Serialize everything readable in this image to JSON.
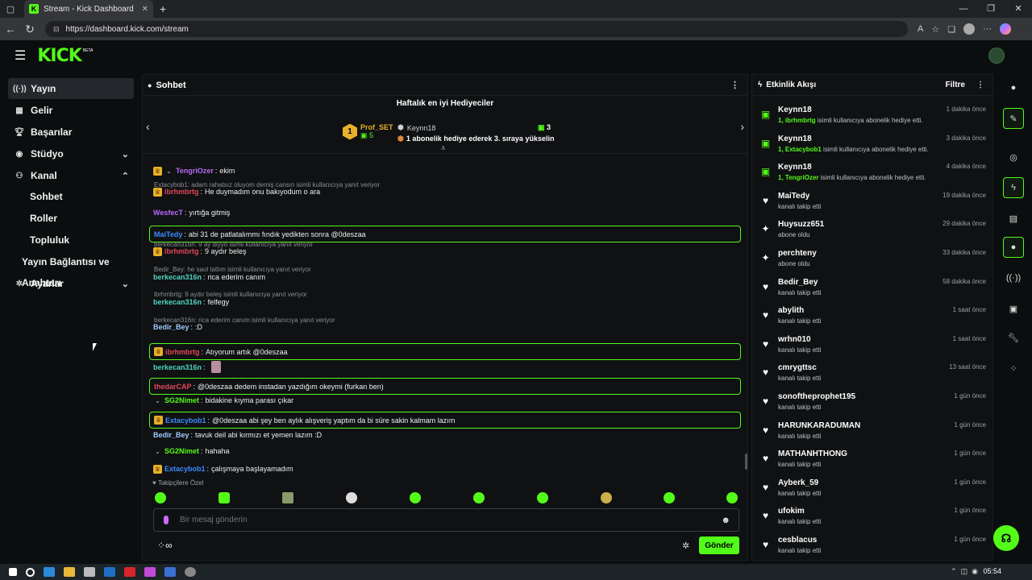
{
  "browser": {
    "tab_title": "Stream - Kick Dashboard",
    "tab_icon_letter": "K",
    "url": "https://dashboard.kick.com/stream"
  },
  "header": {
    "logo": "KICK",
    "beta": "BETA"
  },
  "sidebar": {
    "items": [
      {
        "label": "Yayın",
        "icon": "broadcast-icon"
      },
      {
        "label": "Gelir",
        "icon": "revenue-icon"
      },
      {
        "label": "Başarılar",
        "icon": "trophy-icon"
      },
      {
        "label": "Stüdyo",
        "icon": "studio-icon"
      },
      {
        "label": "Kanal",
        "icon": "channel-icon"
      },
      {
        "label": "Ayarlar",
        "icon": "gear-icon"
      }
    ],
    "subitems": [
      "Sohbet",
      "Roller",
      "Topluluk",
      "Yayın Bağlantısı ve Anahtarı"
    ]
  },
  "chat": {
    "title": "Sohbet",
    "gifters_title": "Haftalık en iyi Hediyeciler",
    "top_gifter": {
      "rank": "1",
      "name": "Prof_SET",
      "count": "5"
    },
    "next_gifter": {
      "name": "Keynn18",
      "count": "3",
      "hint": "1 abonelik hediye ederek 3. sıraya yükselin"
    },
    "messages": [
      {
        "reply": "",
        "user": "TengriOzer",
        "color": "#b96bff",
        "text": "ekim"
      },
      {
        "reply": "Extacybob1: adam rahatsız oluyom demiş cansın isimli kullanıcıya yanıt veriyor",
        "user": "ibrhmbrtg",
        "color": "#e2465a",
        "text": "He duymadım onu bakıyodum o ara"
      },
      {
        "reply": "",
        "user": "WesfecT",
        "color": "#b96bff",
        "text": "yırtığa gitmiş"
      },
      {
        "reply": "",
        "user": "MaiTedy",
        "color": "#3d8bff",
        "text": "abi 31 de patlatalımmı fındık yedikten sonra @0deszaa"
      },
      {
        "reply": "berkecan316n: 9 ay diyyo isimli kullanıcıya yanıt veriyor",
        "user": "ibrhmbrtg",
        "color": "#e2465a",
        "text": "9 aydır beleş"
      },
      {
        "reply": "Bedir_Bey: he saol tatlım isimli kullanıcıya yanıt veriyor",
        "user": "berkecan316n",
        "color": "#4fd4c0",
        "text": "rica ederim canım"
      },
      {
        "reply": "ibrhmbrtg: 9 aydır beleş isimli kullanıcıya yanıt veriyor",
        "user": "berkecan316n",
        "color": "#4fd4c0",
        "text": "felfegy"
      },
      {
        "reply": "berkecan316n: rica ederim canım isimli kullanıcıya yanıt veriyor",
        "user": "Bedir_Bey",
        "color": "#9ecbff",
        "text": ":D"
      },
      {
        "reply": "",
        "user": "ibrhmbrtg",
        "color": "#e2465a",
        "text": "Atıyorum artık @0deszaa"
      },
      {
        "reply": "",
        "user": "berkecan316n",
        "color": "#4fd4c0",
        "text": ""
      },
      {
        "reply": "",
        "user": "thedarCAP",
        "color": "#e2465a",
        "text": "@0deszaa dedem instadan yazdığım okeymi (furkan ben)"
      },
      {
        "reply": "",
        "user": "SG2Nimet",
        "color": "#53fc18",
        "text": "bidakine kıyma parası çıkar"
      },
      {
        "reply": "",
        "user": "Extacybob1",
        "color": "#3d8bff",
        "text": "@0deszaa abi şey ben aylık alışveriş yaptım da bi süre sakin kalmam lazım"
      },
      {
        "reply": "",
        "user": "Bedir_Bey",
        "color": "#9ecbff",
        "text": "tavuk deil abi kırmızı et yemen lazım :D"
      },
      {
        "reply": "",
        "user": "SG2Nimet",
        "color": "#53fc18",
        "text": "hahaha"
      },
      {
        "reply": "",
        "user": "Extacybob1",
        "color": "#3d8bff",
        "text": "çalışmaya başlayamadım"
      }
    ],
    "emote_label": "Takipçilere Özel",
    "input_placeholder": "Bir mesaj gönderin",
    "send_label": "Gönder"
  },
  "feed": {
    "title": "Etkinlik Akışı",
    "filter_label": "Filtre",
    "items": [
      {
        "icon": "gift-icon",
        "name": "Keynn18",
        "time": "1 dakika önce",
        "gift_prefix": "1, ibrhmbrtg",
        "sub": "isimli kullanıcıya abonelik hediye etti."
      },
      {
        "icon": "gift-icon",
        "name": "Keynn18",
        "time": "3 dakika önce",
        "gift_prefix": "1, Extacybob1",
        "sub": "isimli kullanıcıya abonelik hediye etti."
      },
      {
        "icon": "gift-icon",
        "name": "Keynn18",
        "time": "4 dakika önce",
        "gift_prefix": "1, TengriOzer",
        "sub": "isimli kullanıcıya abonelik hediye etti."
      },
      {
        "icon": "heart-icon",
        "name": "MaiTedy",
        "time": "19 dakika önce",
        "gift_prefix": "",
        "sub": "kanalı takip etti"
      },
      {
        "icon": "sparkle-icon",
        "name": "Huysuzz651",
        "time": "29 dakika önce",
        "gift_prefix": "",
        "sub": "abone oldu"
      },
      {
        "icon": "sparkle-icon",
        "name": "perchteny",
        "time": "33 dakika önce",
        "gift_prefix": "",
        "sub": "abone oldu"
      },
      {
        "icon": "heart-icon",
        "name": "Bedir_Bey",
        "time": "58 dakika önce",
        "gift_prefix": "",
        "sub": "kanalı takip etti"
      },
      {
        "icon": "heart-icon",
        "name": "abylith",
        "time": "1 saat önce",
        "gift_prefix": "",
        "sub": "kanalı takip etti"
      },
      {
        "icon": "heart-icon",
        "name": "wrhn010",
        "time": "1 saat önce",
        "gift_prefix": "",
        "sub": "kanalı takip etti"
      },
      {
        "icon": "heart-icon",
        "name": "cmrygttsc",
        "time": "13 saat önce",
        "gift_prefix": "",
        "sub": "kanalı takip etti"
      },
      {
        "icon": "heart-icon",
        "name": "sonoftheprophet195",
        "time": "1 gün önce",
        "gift_prefix": "",
        "sub": "kanalı takip etti"
      },
      {
        "icon": "heart-icon",
        "name": "HARUNKARADUMAN",
        "time": "1 gün önce",
        "gift_prefix": "",
        "sub": "kanalı takip etti"
      },
      {
        "icon": "heart-icon",
        "name": "MATHANHTHONG",
        "time": "1 gün önce",
        "gift_prefix": "",
        "sub": "kanalı takip etti"
      },
      {
        "icon": "heart-icon",
        "name": "Ayberk_59",
        "time": "1 gün önce",
        "gift_prefix": "",
        "sub": "kanalı takip etti"
      },
      {
        "icon": "heart-icon",
        "name": "ufokim",
        "time": "1 gün önce",
        "gift_prefix": "",
        "sub": "kanalı takip etti"
      },
      {
        "icon": "heart-icon",
        "name": "cesblacus",
        "time": "1 gün önce",
        "gift_prefix": "",
        "sub": "kanalı takip etti"
      }
    ]
  },
  "taskbar": {
    "time": "05:54"
  },
  "colors": {
    "accent": "#53fc18",
    "panel": "#0f1113",
    "background": "#0b0e0f"
  }
}
